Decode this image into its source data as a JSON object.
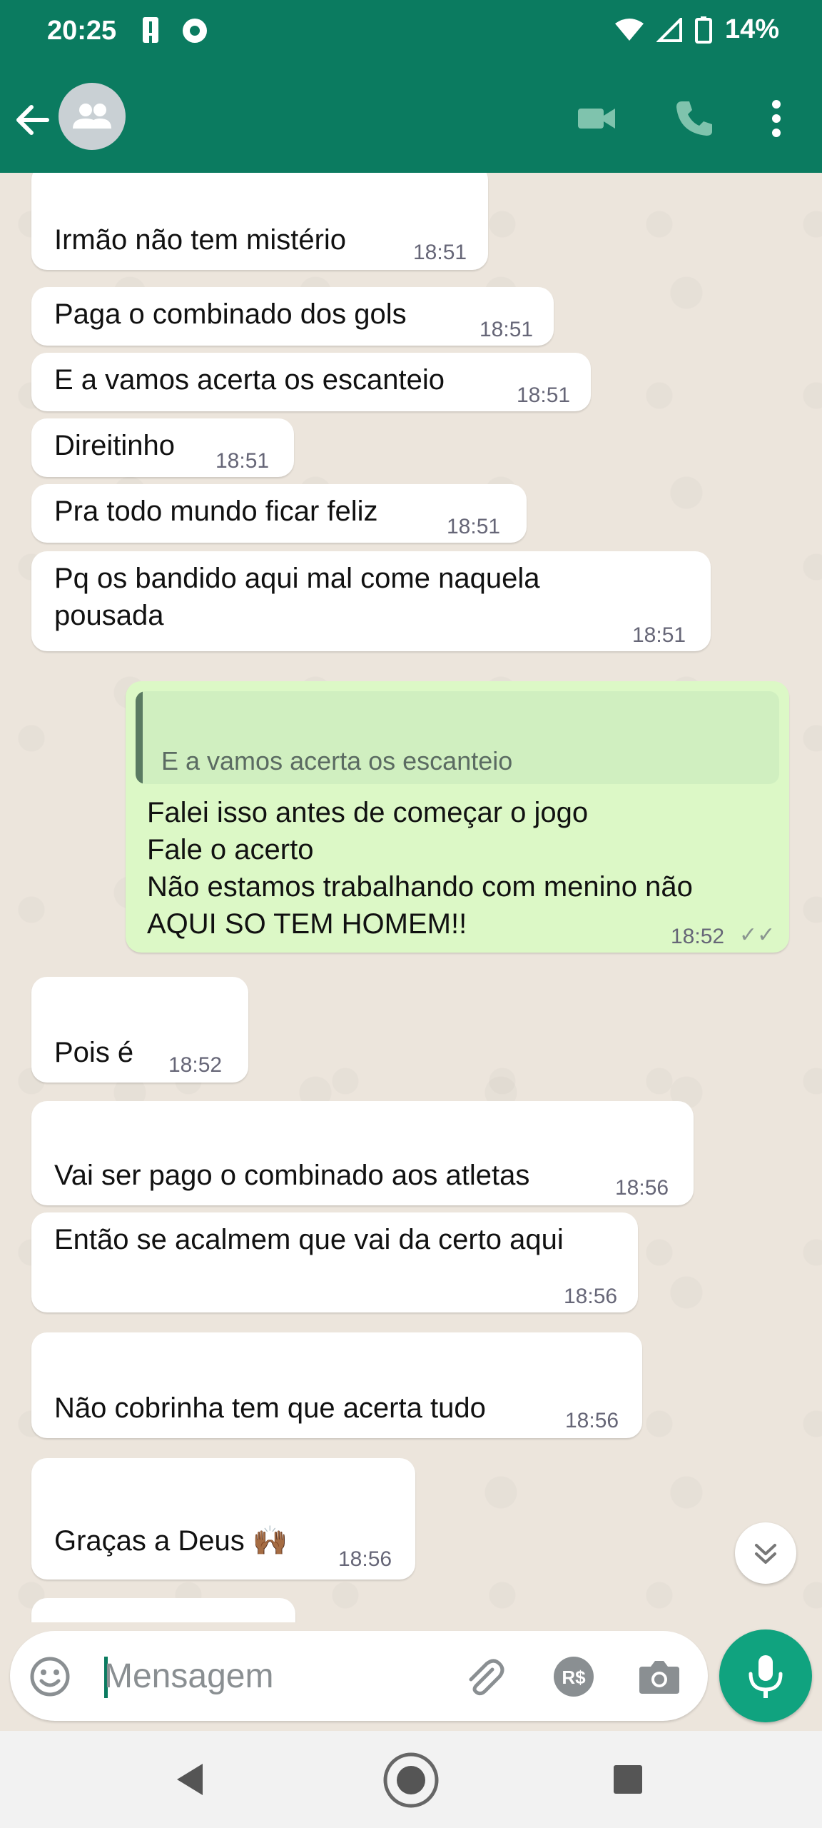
{
  "status_bar": {
    "time": "20:25",
    "battery": "14%"
  },
  "header": {
    "back_icon": "arrow-left",
    "avatar_icon": "group-avatar",
    "video_icon": "video-camera",
    "call_icon": "phone",
    "menu_icon": "more-vertical"
  },
  "messages": [
    {
      "text": "Irmão não tem mistério",
      "time": "18:51"
    },
    {
      "text": "Paga o combinado dos gols",
      "time": "18:51"
    },
    {
      "text": "E a vamos acerta os escanteio",
      "time": "18:51"
    },
    {
      "text": "Direitinho",
      "time": "18:51"
    },
    {
      "text": "Pra todo mundo ficar feliz",
      "time": "18:51"
    },
    {
      "text": "Pq os bandido aqui mal come naquela\npousada",
      "time": "18:51"
    },
    {
      "quote": "E a vamos acerta os escanteio",
      "text": "Falei isso antes de começar o jogo\nFale o acerto\nNão estamos trabalhando com menino não\nAQUI SO TEM HOMEM!!",
      "time": "18:52",
      "ticks": "✓✓"
    },
    {
      "text": "Pois é",
      "time": "18:52"
    },
    {
      "text": "Vai ser pago o combinado aos atletas",
      "time": "18:56"
    },
    {
      "text": "Então se acalmem que vai da certo aqui",
      "time": "18:56"
    },
    {
      "text": "Não cobrinha tem que acerta tudo",
      "time": "18:56"
    },
    {
      "text": "Graças a Deus 🙌🏾",
      "time": "18:56"
    }
  ],
  "input": {
    "placeholder": "Mensagem"
  },
  "colors": {
    "header": "#0b7b60",
    "outgoing_bubble": "#dcf8c6",
    "incoming_bubble": "#ffffff",
    "mic_button": "#10a37f"
  }
}
